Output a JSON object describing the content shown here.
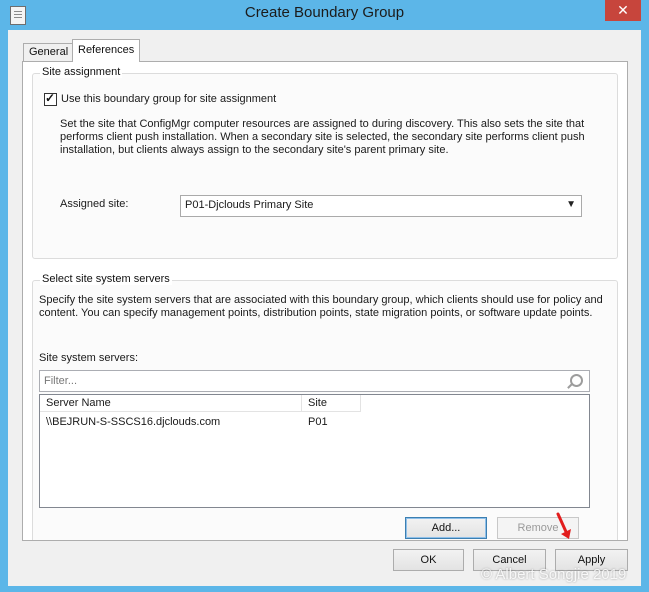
{
  "window": {
    "title": "Create Boundary Group",
    "close_symbol": "✕"
  },
  "tabs": [
    {
      "label": "General",
      "selected": false
    },
    {
      "label": "References",
      "selected": true
    }
  ],
  "site_assignment": {
    "group_title": "Site assignment",
    "checkbox_label": "Use this boundary group for site assignment",
    "checkbox_checked": true,
    "description_lines": [
      "Set the site that ConfigMgr computer resources are assigned to during discovery. This also sets the site that",
      "performs client push installation. When a secondary site is selected, the secondary site performs client push",
      "installation, but clients always assign to the secondary site's parent primary site."
    ],
    "assigned_site_label": "Assigned site:",
    "assigned_site_value": "P01-Djclouds Primary Site"
  },
  "site_system_servers": {
    "group_title": "Select site system servers",
    "description_lines": [
      "Specify the site system servers that are associated with this boundary group, which clients should use for policy and",
      "content. You can specify management points, distribution points, state migration points, or software update points."
    ],
    "list_label": "Site system servers:",
    "filter_placeholder": "Filter...",
    "columns": [
      "Server Name",
      "Site"
    ],
    "rows": [
      {
        "server_name": "\\\\BEJRUN-S-SSCS16.djclouds.com",
        "site": "P01"
      }
    ],
    "add_button": "Add...",
    "remove_button": "Remove"
  },
  "footer": {
    "ok": "OK",
    "cancel": "Cancel",
    "apply": "Apply"
  },
  "watermark": "© Albert Songjie 2019"
}
